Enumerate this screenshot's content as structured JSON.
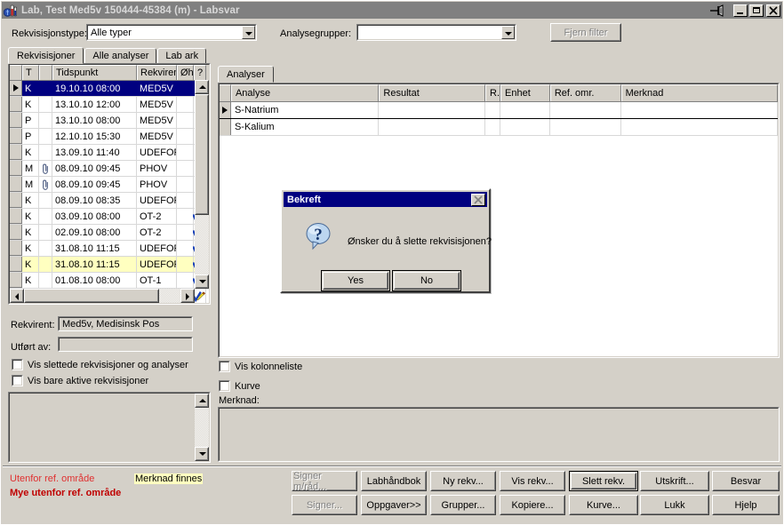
{
  "window": {
    "title": "Lab, Test Med5v  150444-45384 (m) - Labsvar",
    "icon": "lab-flask-icon",
    "pin_icon": "pushpin-icon",
    "minimize_label": "Minimize",
    "maximize_label": "Maximize",
    "close_label": "Close",
    "titlebar_color": "#808080",
    "face_color": "#d4d0c8"
  },
  "filter": {
    "rekvisisjonstype_label": "Rekvisisjonstype:",
    "rekvisisjonstype_value": "Alle typer",
    "analysegrupper_label": "Analysegrupper:",
    "analysegrupper_value": "",
    "fjern_filter_label": "Fjern filter",
    "fjern_filter_disabled": true
  },
  "tabs": [
    {
      "label": "Rekvisisjoner",
      "active": true
    },
    {
      "label": "Alle analyser",
      "active": false
    },
    {
      "label": "Lab ark",
      "active": false
    }
  ],
  "rekvisisjon_grid": {
    "columns": [
      "",
      "T",
      "",
      "Tidspunkt",
      "Rekvirent",
      "Øhj",
      "?"
    ],
    "rows": [
      {
        "t": "K",
        "attach": false,
        "tidspunkt": "19.10.10 08:00",
        "rekvirent": "MED5V",
        "ohj": "",
        "mark": "",
        "state": "selected"
      },
      {
        "t": "K",
        "attach": false,
        "tidspunkt": "13.10.10 12:00",
        "rekvirent": "MED5V",
        "ohj": "",
        "mark": "",
        "state": "normal"
      },
      {
        "t": "P",
        "attach": false,
        "tidspunkt": "13.10.10 08:00",
        "rekvirent": "MED5V",
        "ohj": "",
        "mark": "",
        "state": "normal"
      },
      {
        "t": "P",
        "attach": false,
        "tidspunkt": "12.10.10 15:30",
        "rekvirent": "MED5V",
        "ohj": "",
        "mark": "pencil",
        "state": "normal"
      },
      {
        "t": "K",
        "attach": false,
        "tidspunkt": "13.09.10 11:40",
        "rekvirent": "UDEFORT",
        "ohj": "",
        "mark": "pencil",
        "state": "normal"
      },
      {
        "t": "M",
        "attach": true,
        "tidspunkt": "08.09.10 09:45",
        "rekvirent": "PHOV",
        "ohj": "",
        "mark": "pencil",
        "state": "normal"
      },
      {
        "t": "M",
        "attach": true,
        "tidspunkt": "08.09.10 09:45",
        "rekvirent": "PHOV",
        "ohj": "",
        "mark": "pencil",
        "state": "normal"
      },
      {
        "t": "K",
        "attach": false,
        "tidspunkt": "08.09.10 08:35",
        "rekvirent": "UDEFORT",
        "ohj": "",
        "mark": "pencil",
        "state": "normal"
      },
      {
        "t": "K",
        "attach": false,
        "tidspunkt": "03.09.10 08:00",
        "rekvirent": "OT-2",
        "ohj": "",
        "mark": "check-pencil",
        "state": "normal"
      },
      {
        "t": "K",
        "attach": false,
        "tidspunkt": "02.09.10 08:00",
        "rekvirent": "OT-2",
        "ohj": "",
        "mark": "check-pencil",
        "state": "normal"
      },
      {
        "t": "K",
        "attach": false,
        "tidspunkt": "31.08.10 11:15",
        "rekvirent": "UDEFORT",
        "ohj": "",
        "mark": "check-pencil",
        "state": "normal"
      },
      {
        "t": "K",
        "attach": false,
        "tidspunkt": "31.08.10 11:15",
        "rekvirent": "UDEFORT",
        "ohj": "",
        "mark": "check-pencil",
        "state": "highlight"
      },
      {
        "t": "K",
        "attach": false,
        "tidspunkt": "01.08.10 08:00",
        "rekvirent": "OT-1",
        "ohj": "",
        "mark": "check-pencil",
        "state": "normal"
      },
      {
        "t": "K",
        "attach": false,
        "tidspunkt": "31.07.10 08:00",
        "rekvirent": "OT-1",
        "ohj": "",
        "mark": "check-pencil",
        "state": "normal"
      }
    ]
  },
  "details": {
    "rekvirent_label": "Rekvirent:",
    "rekvirent_value": "Med5v, Medisinsk Pos",
    "utfort_av_label": "Utført av:",
    "utfort_av_value": "",
    "checkbox_slettede": "Vis slettede rekvisisjoner og analyser",
    "checkbox_slettede_checked": false,
    "checkbox_aktive": "Vis bare aktive rekvisisjoner",
    "checkbox_aktive_checked": false,
    "notes_value": ""
  },
  "analyser": {
    "tab_label": "Analyser",
    "columns": [
      "",
      "Analyse",
      "Resultat",
      "R..",
      "Enhet",
      "Ref. omr.",
      "Merknad"
    ],
    "rows": [
      {
        "analyse": "S-Natrium",
        "resultat": "",
        "r": "",
        "enhet": "",
        "ref": "",
        "merknad": "",
        "current": true
      },
      {
        "analyse": "S-Kalium",
        "resultat": "",
        "r": "",
        "enhet": "",
        "ref": "",
        "merknad": "",
        "current": false
      }
    ],
    "checkbox_kolonneliste": "Vis kolonneliste",
    "checkbox_kolonneliste_checked": false,
    "checkbox_kurve": "Kurve",
    "checkbox_kurve_checked": false,
    "merknad_label": "Merknad:",
    "merknad_value": ""
  },
  "legend": {
    "utenfor": "Utenfor ref. område",
    "mye_utenfor": "Mye utenfor ref. område",
    "merknad_finnes": "Merknad finnes",
    "color_utenfor": "#e03030",
    "color_mye_utenfor": "#c00000",
    "color_merknad_bg": "#ffffc0"
  },
  "buttons": {
    "row1": [
      {
        "label": "Signer m/råd...",
        "disabled": true,
        "default": false
      },
      {
        "label": "Labhåndbok",
        "disabled": false,
        "default": false
      },
      {
        "label": "Ny rekv...",
        "disabled": false,
        "default": false
      },
      {
        "label": "Vis rekv...",
        "disabled": false,
        "default": false
      },
      {
        "label": "Slett rekv.",
        "disabled": false,
        "default": true
      },
      {
        "label": "Utskrift...",
        "disabled": false,
        "default": false
      },
      {
        "label": "Besvar",
        "disabled": false,
        "default": false
      }
    ],
    "row2": [
      {
        "label": "Signer...",
        "disabled": true,
        "default": false
      },
      {
        "label": "Oppgaver>>",
        "disabled": false,
        "default": false
      },
      {
        "label": "Grupper...",
        "disabled": false,
        "default": false
      },
      {
        "label": "Kopiere...",
        "disabled": false,
        "default": false
      },
      {
        "label": "Kurve...",
        "disabled": false,
        "default": false
      },
      {
        "label": "Lukk",
        "disabled": false,
        "default": false
      },
      {
        "label": "Hjelp",
        "disabled": false,
        "default": false
      }
    ]
  },
  "dialog": {
    "title": "Bekreft",
    "message": "Ønsker du å slette rekvisisjonen?",
    "icon": "question-icon",
    "close_label": "Close",
    "yes_label": "Yes",
    "no_label": "No",
    "titlebar_color": "#000080"
  }
}
